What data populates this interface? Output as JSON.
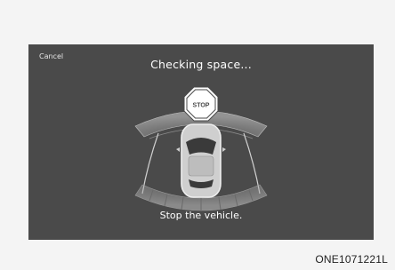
{
  "screen": {
    "cancel_label": "Cancel",
    "title": "Checking space...",
    "status_message": "Stop the vehicle.",
    "stop_sign_text": "STOP"
  },
  "caption": "ONE1071221L",
  "colors": {
    "screen_background": "#4a4a4a",
    "page_background": "#f4f4f4",
    "text": "#ffffff",
    "stop_sign": "#ffffff"
  }
}
